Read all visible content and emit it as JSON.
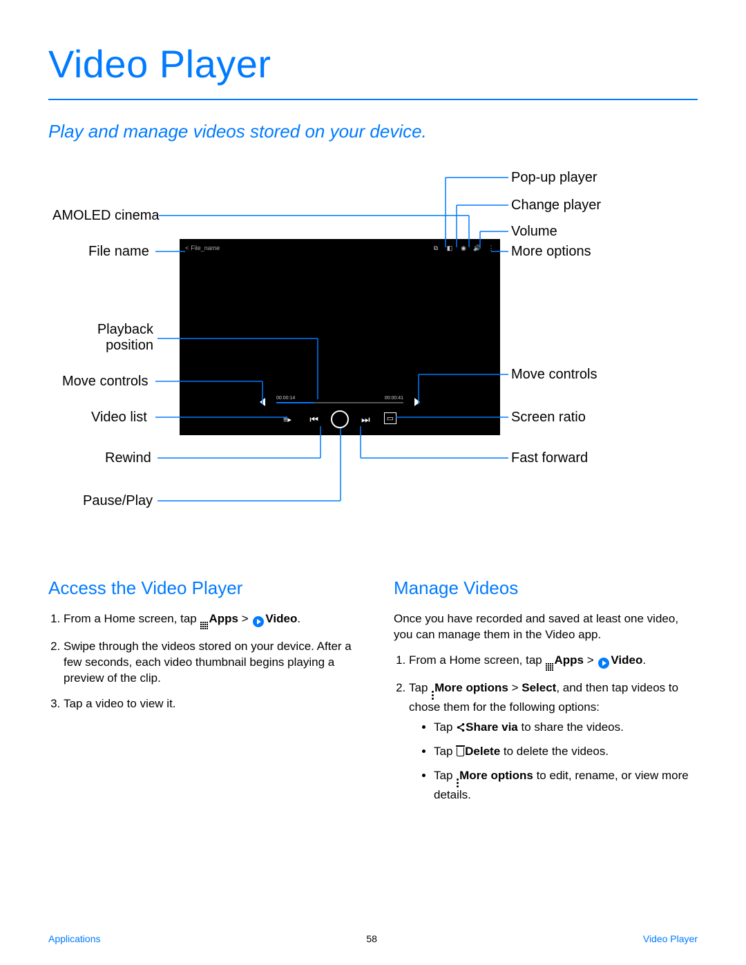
{
  "title": "Video Player",
  "subtitle": "Play and manage videos stored on your device.",
  "diagram": {
    "left_labels": {
      "amoled": "AMOLED cinema",
      "file_name": "File name",
      "playback": "Playback position",
      "move": "Move controls",
      "video_list": "Video list",
      "rewind": "Rewind",
      "pause": "Pause/Play"
    },
    "right_labels": {
      "popup": "Pop-up player",
      "change": "Change player",
      "volume": "Volume",
      "more": "More options",
      "move": "Move controls",
      "ratio": "Screen ratio",
      "ff": "Fast forward"
    },
    "player": {
      "filename": "File_name",
      "time_current": "00:00:14",
      "time_total": "00:00:41"
    }
  },
  "sections": {
    "access": {
      "title": "Access the Video Player",
      "step1_a": "From a Home screen, tap ",
      "step1_apps": "Apps",
      "step1_b": " > ",
      "step1_video": "Video",
      "step1_c": ".",
      "step2": "Swipe through the videos stored on your device. After a few seconds, each video thumbnail begins playing a preview of the clip.",
      "step3": "Tap a video to view it."
    },
    "manage": {
      "title": "Manage Videos",
      "intro": "Once you have recorded and saved at least one video, you can manage them in the Video app.",
      "step1_a": "From a Home screen, tap ",
      "step1_apps": "Apps",
      "step1_b": " > ",
      "step1_video": "Video",
      "step1_c": ".",
      "step2_a": "Tap ",
      "step2_more": "More options",
      "step2_b": " > ",
      "step2_select": "Select",
      "step2_c": ", and then tap videos to chose them for the following options:",
      "b1_a": "Tap ",
      "b1_share": "Share via",
      "b1_b": " to share the videos.",
      "b2_a": "Tap ",
      "b2_delete": "Delete",
      "b2_b": "  to delete the videos.",
      "b3_a": "Tap ",
      "b3_more": "More options",
      "b3_b": " to edit, rename, or view more details."
    }
  },
  "footer": {
    "left": "Applications",
    "page": "58",
    "right": "Video Player"
  }
}
